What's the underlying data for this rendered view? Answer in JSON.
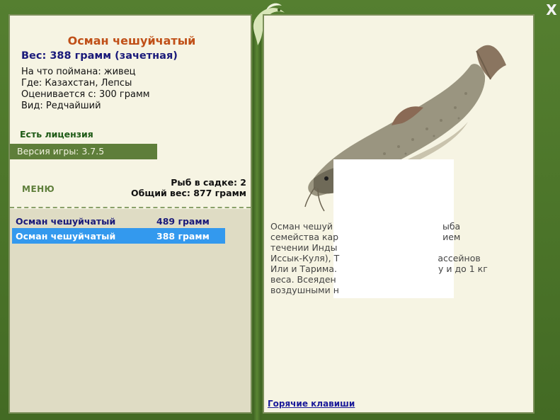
{
  "fish": {
    "title": "Осман чешуйчатый",
    "weight_line": "Вес: 388 грамм (зачетная)",
    "bait": "На что поймана: живец",
    "location": "Где: Казахстан, Лепсы",
    "threshold": "Оценивается с: 300 грамм",
    "rarity": "Вид: Редчайший"
  },
  "license": "Есть лицензия",
  "version": "Версия игры: 3.7.5",
  "menu_label": "МЕНЮ",
  "cage": {
    "count_text": "Рыб в садке: 2",
    "total_text": "Общий вес: 877 грамм"
  },
  "catch_list": [
    {
      "name": "Осман чешуйчатый",
      "weight": "489 грамм"
    },
    {
      "name": "Осман чешуйчатый",
      "weight": "388 грамм"
    }
  ],
  "description_lines": [
    "Осман чешуй                                       ыба",
    "семейства кар                                     ием",
    "течении Инды                                      ",
    "Иссык-Куля), Т                                   ассейнов",
    "Или и Тарима.                                    у и до 1 кг",
    "веса. Всеяден",
    "воздушными н"
  ],
  "hotkeys_label": "Горячие клавиши",
  "close_label": "X",
  "colors": {
    "frame": "#4f7a2c",
    "panel": "#f6f4e3",
    "title": "#c05018",
    "weight": "#1a1a7a",
    "license": "#1e5a16",
    "selected_row": "#3399ee"
  }
}
